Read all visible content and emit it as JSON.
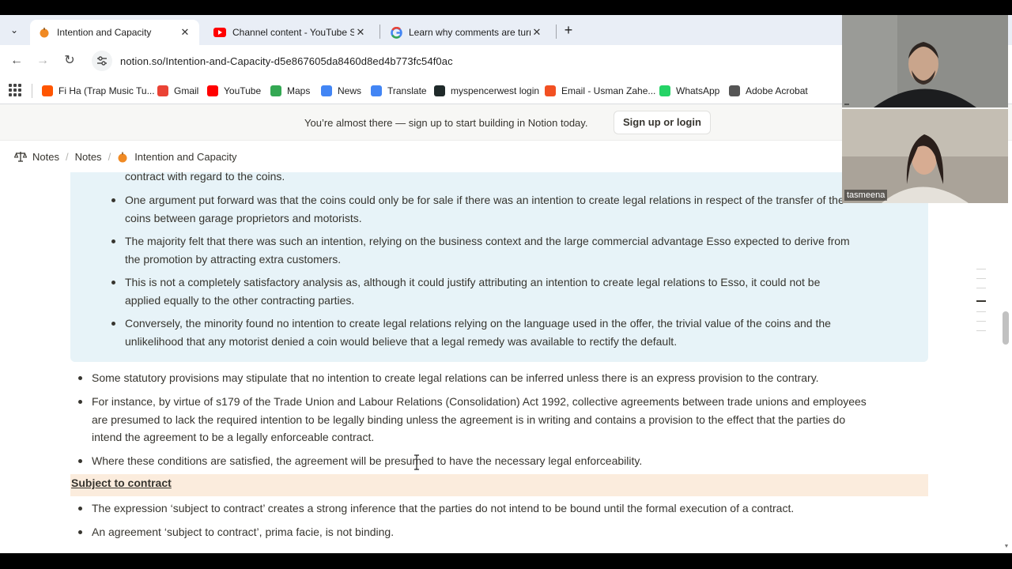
{
  "browser": {
    "tabs": [
      {
        "title": "Intention and Capacity",
        "active": true,
        "icon": "notion-orange-favicon"
      },
      {
        "title": "Channel content - YouTube Stu",
        "active": false,
        "icon": "youtube-studio-favicon"
      },
      {
        "title": "Learn why comments are turne",
        "active": false,
        "icon": "google-favicon"
      }
    ],
    "tab_close_glyph": "✕",
    "new_tab_glyph": "+",
    "url": "notion.so/Intention-and-Capacity-d5e867605da8460d8ed4b773fc54f0ac",
    "bookmarks": [
      {
        "label": "Fi Ha (Trap Music Tu...",
        "icon": "soundcloud-icon",
        "color": "#ff5500"
      },
      {
        "label": "Gmail",
        "icon": "gmail-icon",
        "color": "#ea4335"
      },
      {
        "label": "YouTube",
        "icon": "youtube-icon",
        "color": "#ff0000"
      },
      {
        "label": "Maps",
        "icon": "maps-icon",
        "color": "#34a853"
      },
      {
        "label": "News",
        "icon": "news-icon",
        "color": "#4285f4"
      },
      {
        "label": "Translate",
        "icon": "translate-icon",
        "color": "#4285f4"
      },
      {
        "label": "myspencerwest login",
        "icon": "spencerwest-icon",
        "color": "#1f2a2a"
      },
      {
        "label": "Email - Usman Zahe...",
        "icon": "microsoft-icon",
        "color": "#f25022"
      },
      {
        "label": "WhatsApp",
        "icon": "whatsapp-icon",
        "color": "#25d366"
      },
      {
        "label": "Adobe Acrobat",
        "icon": "globe-icon",
        "color": "#555555"
      }
    ]
  },
  "banner": {
    "text": "You’re almost there — sign up to start building in Notion today.",
    "button": "Sign up or login"
  },
  "breadcrumb": [
    "Notes",
    "Notes",
    "Intention and Capacity"
  ],
  "content": {
    "callout_items": [
      {
        "lines": [
          "contract with regard to the coins."
        ],
        "partial": true
      },
      {
        "lines": [
          "One argument put forward was that the coins could only be for sale if there was an intention to create legal relations in respect of the transfer of the",
          "coins between garage proprietors and motorists."
        ]
      },
      {
        "lines": [
          "The majority felt that there was such an intention, relying on the business context and the large commercial advantage Esso expected to derive from",
          "the promotion by attracting extra customers."
        ]
      },
      {
        "lines": [
          "This is not a completely satisfactory analysis as, although it could justify attributing an intention to create legal relations to Esso, it could not be",
          "applied equally to the other contracting parties."
        ]
      },
      {
        "lines": [
          "Conversely, the minority found no intention to create legal relations relying on the language used in the offer, the trivial value of the coins and the",
          "unlikelihood that any motorist denied a coin would believe that a legal remedy was available to rectify the default."
        ]
      }
    ],
    "bullets": [
      {
        "lines": [
          "Some statutory provisions may stipulate that no intention to create legal relations can be inferred unless there is an express provision to the contrary."
        ]
      },
      {
        "lines": [
          "For instance, by virtue of s179 of the Trade Union and Labour Relations (Consolidation) Act 1992, collective agreements between trade unions and employees",
          "are presumed to lack the required intention to be legally binding unless the agreement is in writing and contains a provision to the effect that the parties do",
          "intend the agreement to be a legally enforceable contract."
        ]
      },
      {
        "lines": [
          "Where these conditions are satisfied, the agreement will be presumed to have the necessary legal enforceability."
        ]
      }
    ],
    "heading": "Subject to contract",
    "heading_bullets": [
      {
        "lines": [
          "The expression ‘subject to contract’ creates a strong inference that the parties do not intend to be bound until the formal execution of a contract."
        ]
      },
      {
        "lines": [
          "An agreement ‘subject to contract’, prima facie, is not binding."
        ]
      }
    ]
  },
  "video_call": {
    "participants": [
      {
        "name": ""
      },
      {
        "name": "tasmeena"
      }
    ]
  },
  "colors": {
    "callout_bg": "#e7f3f8",
    "heading_bg": "#fbecdd",
    "text": "#37352f"
  }
}
